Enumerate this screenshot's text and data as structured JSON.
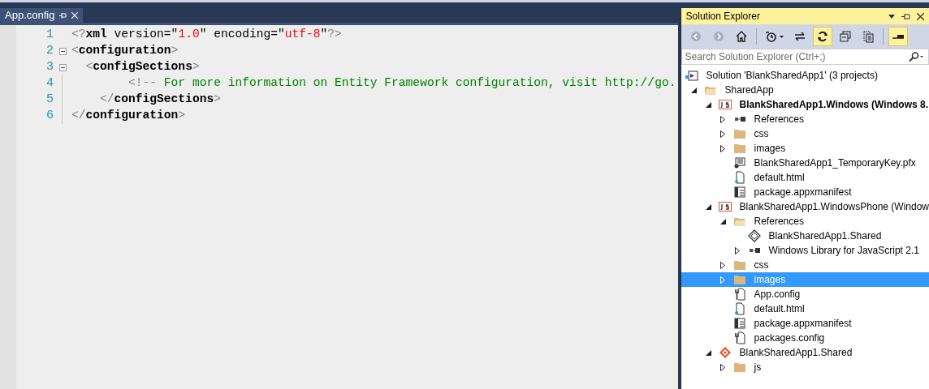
{
  "editor_tab": {
    "title": "App.config",
    "selected": true
  },
  "code_lines": [
    {
      "number": "1",
      "fold": false,
      "tokens": [
        {
          "kind": "punct",
          "text": "<?"
        },
        {
          "kind": "name",
          "text": "xml"
        },
        {
          "kind": "attr",
          "text": " version=\""
        },
        {
          "kind": "value",
          "text": "1.0"
        },
        {
          "kind": "attr",
          "text": "\" encoding=\""
        },
        {
          "kind": "value",
          "text": "utf-8"
        },
        {
          "kind": "attr",
          "text": "\""
        },
        {
          "kind": "punct",
          "text": "?>"
        }
      ]
    },
    {
      "number": "2",
      "fold": true,
      "tokens": [
        {
          "kind": "punct",
          "text": "<"
        },
        {
          "kind": "name",
          "text": "configuration"
        },
        {
          "kind": "punct",
          "text": ">"
        }
      ]
    },
    {
      "number": "3",
      "fold": true,
      "tokens": [
        {
          "kind": "punct",
          "text": "  <"
        },
        {
          "kind": "name",
          "text": "configSections"
        },
        {
          "kind": "punct",
          "text": ">"
        }
      ]
    },
    {
      "number": "4",
      "fold": false,
      "tokens": [
        {
          "kind": "punct",
          "text": "        <!--"
        },
        {
          "kind": "comment",
          "text": " For more information on Entity Framework configuration, visit http://go."
        }
      ]
    },
    {
      "number": "5",
      "fold": false,
      "tokens": [
        {
          "kind": "punct",
          "text": "    </"
        },
        {
          "kind": "name",
          "text": "configSections"
        },
        {
          "kind": "punct",
          "text": ">"
        }
      ]
    },
    {
      "number": "6",
      "fold": false,
      "tokens": [
        {
          "kind": "punct",
          "text": "</"
        },
        {
          "kind": "name",
          "text": "configuration"
        },
        {
          "kind": "punct",
          "text": ">"
        }
      ]
    }
  ],
  "solution_explorer": {
    "title": "Solution Explorer",
    "toolbar": [
      {
        "kind": "back",
        "disabled": true,
        "on": false
      },
      {
        "kind": "forward",
        "disabled": true,
        "on": false
      },
      {
        "kind": "home",
        "disabled": false,
        "on": false
      },
      {
        "kind": "separator"
      },
      {
        "kind": "history",
        "disabled": false,
        "on": false
      },
      {
        "kind": "sync",
        "disabled": false,
        "on": false
      },
      {
        "kind": "refresh",
        "disabled": false,
        "on": true
      },
      {
        "kind": "collapse",
        "disabled": false,
        "on": false
      },
      {
        "kind": "showall",
        "disabled": false,
        "on": false
      },
      {
        "kind": "separator"
      },
      {
        "kind": "preview",
        "disabled": false,
        "on": true
      }
    ],
    "search": {
      "placeholder": "Search Solution Explorer (Ctrl+;)"
    },
    "tree": [
      {
        "label": "Solution 'BlankSharedApp1' (3 projects)",
        "kind": "solution",
        "selected": false,
        "bold": false,
        "children": [
          {
            "label": "SharedApp",
            "kind": "folder-open",
            "expanded": true,
            "selected": false,
            "bold": false,
            "children": [
              {
                "label": "BlankSharedApp1.Windows (Windows 8.",
                "kind": "js-project",
                "expanded": true,
                "selected": false,
                "bold": true,
                "children": [
                  {
                    "label": "References",
                    "kind": "references",
                    "expanded": false,
                    "selected": false,
                    "bold": false
                  },
                  {
                    "label": "css",
                    "kind": "folder",
                    "expanded": false,
                    "selected": false,
                    "bold": false
                  },
                  {
                    "label": "images",
                    "kind": "folder",
                    "expanded": false,
                    "selected": false,
                    "bold": false
                  },
                  {
                    "label": "BlankSharedApp1_TemporaryKey.pfx",
                    "kind": "certificate",
                    "selected": false,
                    "bold": false
                  },
                  {
                    "label": "default.html",
                    "kind": "html",
                    "selected": false,
                    "bold": false
                  },
                  {
                    "label": "package.appxmanifest",
                    "kind": "manifest",
                    "selected": false,
                    "bold": false
                  }
                ]
              },
              {
                "label": "BlankSharedApp1.WindowsPhone (Window",
                "kind": "js-project",
                "expanded": true,
                "selected": false,
                "bold": false,
                "children": [
                  {
                    "label": "References",
                    "kind": "folder-open",
                    "expanded": true,
                    "selected": false,
                    "bold": false,
                    "children": [
                      {
                        "label": "BlankSharedApp1.Shared",
                        "kind": "shared-ref",
                        "selected": false,
                        "bold": false
                      },
                      {
                        "label": "Windows Library for JavaScript 2.1",
                        "kind": "references",
                        "expanded": false,
                        "selected": false,
                        "bold": false
                      }
                    ]
                  },
                  {
                    "label": "css",
                    "kind": "folder",
                    "expanded": false,
                    "selected": false,
                    "bold": false
                  },
                  {
                    "label": "images",
                    "kind": "folder",
                    "expanded": false,
                    "selected": true,
                    "bold": false
                  },
                  {
                    "label": "App.config",
                    "kind": "config",
                    "selected": false,
                    "bold": false
                  },
                  {
                    "label": "default.html",
                    "kind": "html",
                    "selected": false,
                    "bold": false
                  },
                  {
                    "label": "package.appxmanifest",
                    "kind": "manifest",
                    "selected": false,
                    "bold": false
                  },
                  {
                    "label": "packages.config",
                    "kind": "config",
                    "selected": false,
                    "bold": false
                  }
                ]
              },
              {
                "label": "BlankSharedApp1.Shared",
                "kind": "shared-project",
                "expanded": true,
                "selected": false,
                "bold": false,
                "children": [
                  {
                    "label": "js",
                    "kind": "folder",
                    "expanded": false,
                    "selected": false,
                    "bold": false
                  }
                ]
              }
            ]
          }
        ]
      }
    ]
  }
}
